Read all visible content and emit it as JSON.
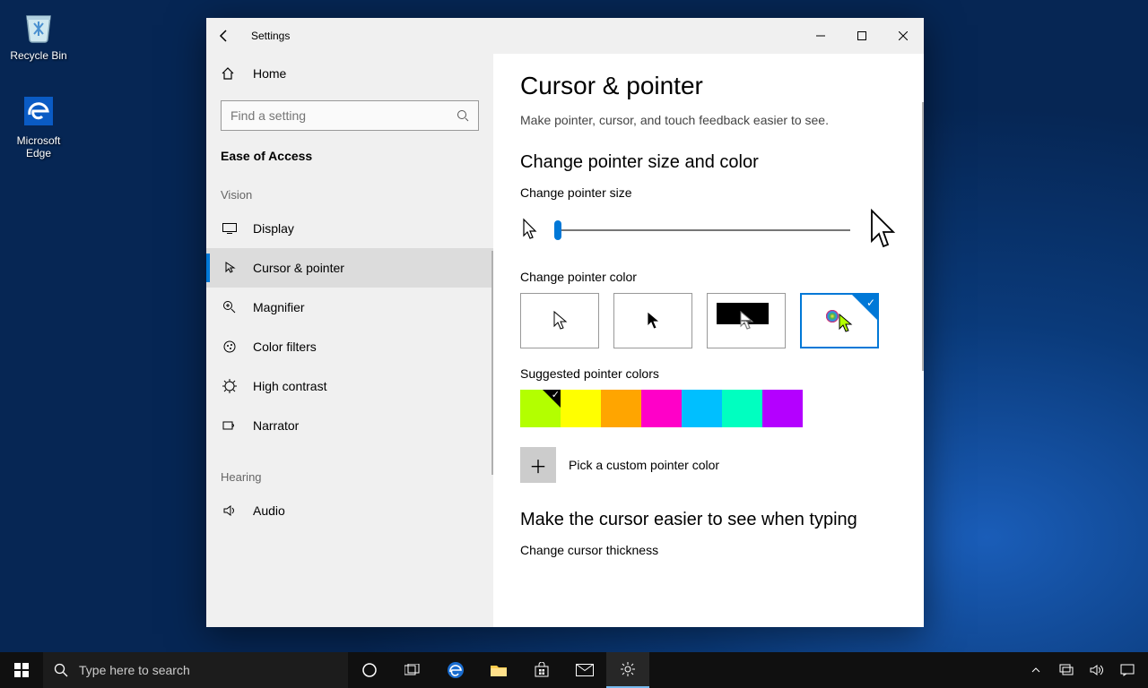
{
  "desktop": {
    "recycle_bin": "Recycle Bin",
    "edge": "Microsoft Edge"
  },
  "window": {
    "title": "Settings"
  },
  "sidebar": {
    "home": "Home",
    "search_placeholder": "Find a setting",
    "category": "Ease of Access",
    "groups": {
      "vision": "Vision",
      "hearing": "Hearing"
    },
    "items": {
      "display": "Display",
      "cursor": "Cursor & pointer",
      "magnifier": "Magnifier",
      "color_filters": "Color filters",
      "high_contrast": "High contrast",
      "narrator": "Narrator",
      "audio": "Audio"
    }
  },
  "content": {
    "title": "Cursor & pointer",
    "description": "Make pointer, cursor, and touch feedback easier to see.",
    "section1": "Change pointer size and color",
    "size_label": "Change pointer size",
    "color_label": "Change pointer color",
    "suggested_label": "Suggested pointer colors",
    "custom_label": "Pick a custom pointer color",
    "section2": "Make the cursor easier to see when typing",
    "thickness_label": "Change cursor thickness"
  },
  "colors": {
    "suggested": [
      "#b3ff00",
      "#ffff00",
      "#ffa500",
      "#ff00c8",
      "#00bfff",
      "#00ffc0",
      "#b400ff"
    ],
    "selected_index": 0
  },
  "taskbar": {
    "search": "Type here to search"
  }
}
